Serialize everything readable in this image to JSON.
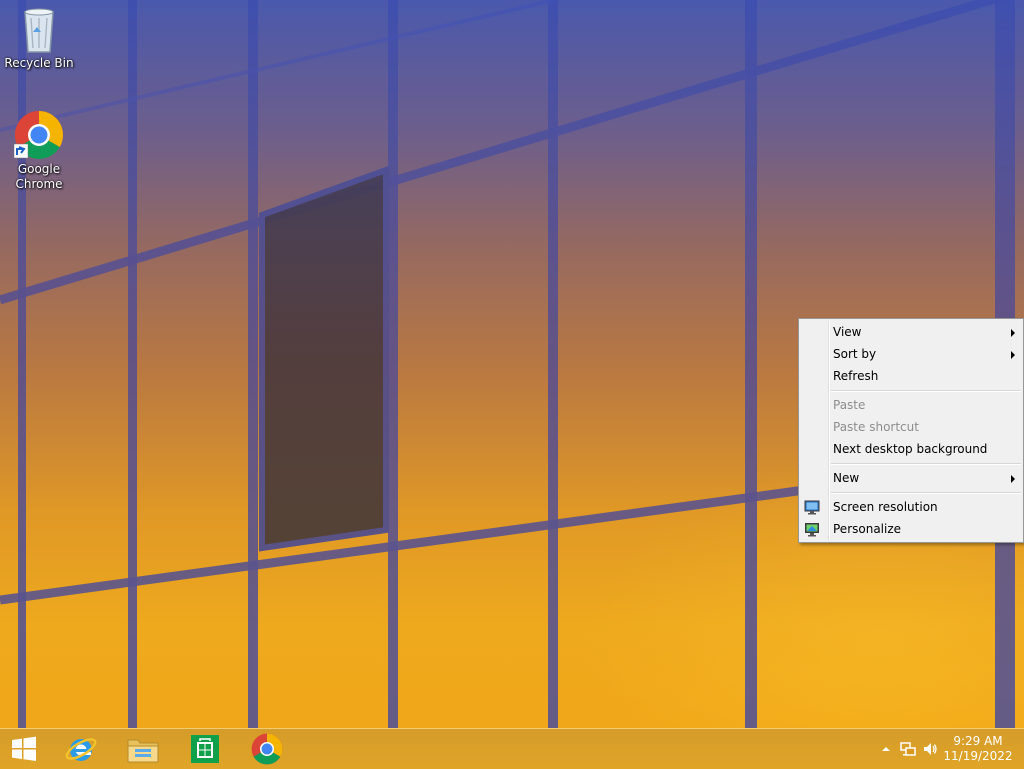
{
  "desktop": {
    "icons": [
      {
        "label": "Recycle Bin",
        "icon": "recycle-bin-icon"
      },
      {
        "label": "Google\nChrome",
        "label_line1": "Google",
        "label_line2": "Chrome",
        "icon": "chrome-icon"
      }
    ]
  },
  "context_menu": {
    "items": [
      {
        "label": "View",
        "submenu": true,
        "enabled": true
      },
      {
        "label": "Sort by",
        "submenu": true,
        "enabled": true
      },
      {
        "label": "Refresh",
        "enabled": true
      },
      {
        "label": "Paste",
        "enabled": false
      },
      {
        "label": "Paste shortcut",
        "enabled": false
      },
      {
        "label": "Next desktop background",
        "enabled": true
      },
      {
        "label": "New",
        "submenu": true,
        "enabled": true
      },
      {
        "label": "Screen resolution",
        "enabled": true,
        "icon": "monitor-icon"
      },
      {
        "label": "Personalize",
        "enabled": true,
        "icon": "personalize-icon"
      }
    ]
  },
  "taskbar": {
    "pinned": [
      "windows-start-icon",
      "internet-explorer-icon",
      "file-explorer-icon",
      "windows-store-icon",
      "chrome-icon"
    ],
    "tray_icons": [
      "show-hidden-icons-chevron",
      "network-icon",
      "volume-icon"
    ],
    "clock": {
      "time": "9:29 AM",
      "date": "11/19/2022"
    }
  },
  "colors": {
    "menu_background": "#f0f0f0",
    "taskbar": "#d9991e",
    "frame_blue": "#2a3ea8"
  }
}
